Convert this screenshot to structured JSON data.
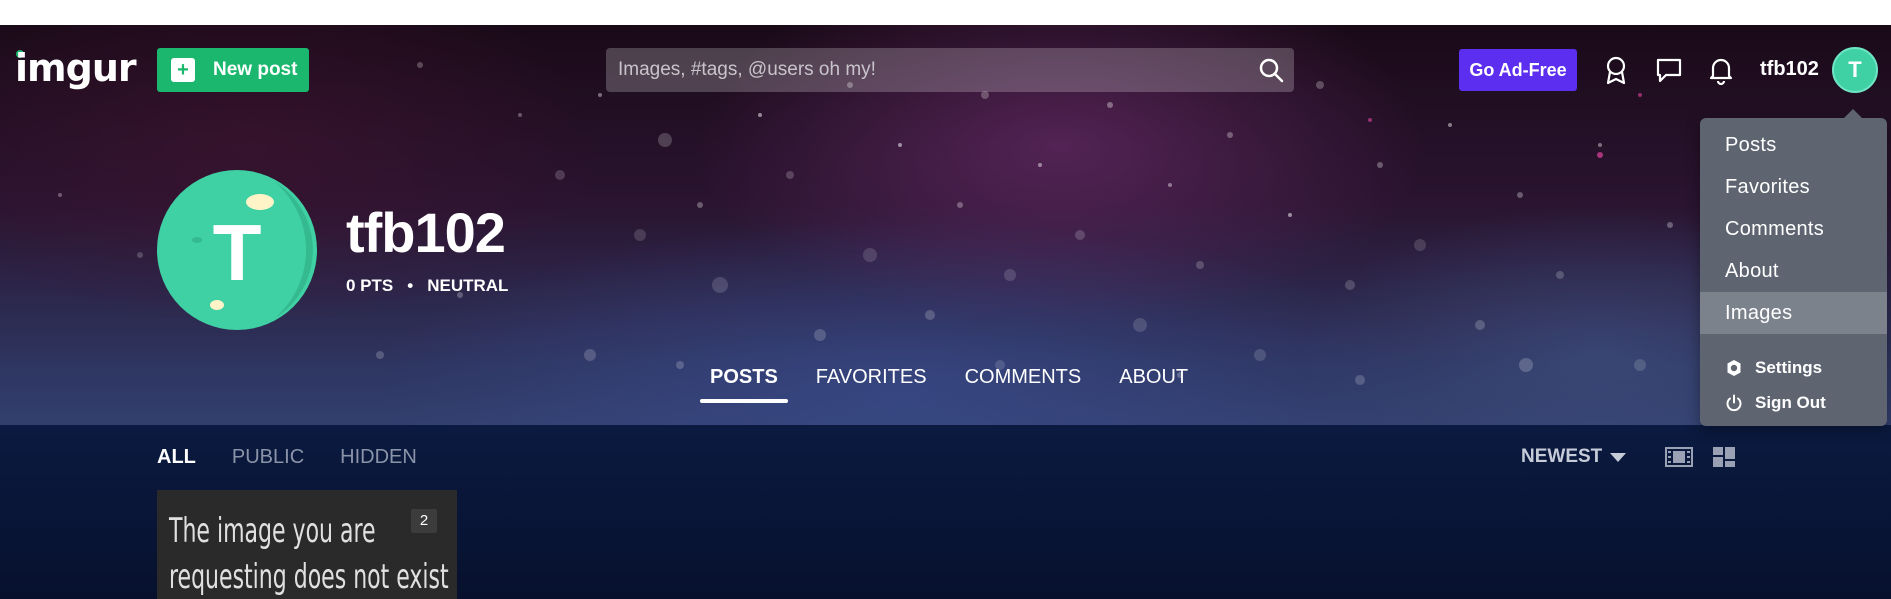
{
  "header": {
    "logo": "imgur",
    "new_post_label": "New post",
    "search_placeholder": "Images, #tags, @users oh my!",
    "ad_free_label": "Go Ad-Free",
    "username": "tfb102",
    "avatar_letter": "T"
  },
  "profile": {
    "name": "tfb102",
    "avatar_letter": "T",
    "points": "0 PTS",
    "separator": "•",
    "reputation": "NEUTRAL"
  },
  "tabs": [
    {
      "label": "POSTS",
      "active": true
    },
    {
      "label": "FAVORITES",
      "active": false
    },
    {
      "label": "COMMENTS",
      "active": false
    },
    {
      "label": "ABOUT",
      "active": false
    }
  ],
  "filters": [
    {
      "label": "ALL",
      "active": true
    },
    {
      "label": "PUBLIC",
      "active": false
    },
    {
      "label": "HIDDEN",
      "active": false
    }
  ],
  "sort": {
    "label": "NEWEST"
  },
  "posts": [
    {
      "text_line1": "The image you are",
      "text_line2": "requesting does not exist",
      "count": "2"
    }
  ],
  "dropdown": {
    "items": [
      {
        "label": "Posts"
      },
      {
        "label": "Favorites"
      },
      {
        "label": "Comments"
      },
      {
        "label": "About"
      },
      {
        "label": "Images"
      }
    ],
    "settings_label": "Settings",
    "signout_label": "Sign Out"
  },
  "colors": {
    "brand_green": "#1bb76e",
    "ad_free_purple": "#5c2ff0",
    "avatar_teal": "#3fd0a4"
  }
}
